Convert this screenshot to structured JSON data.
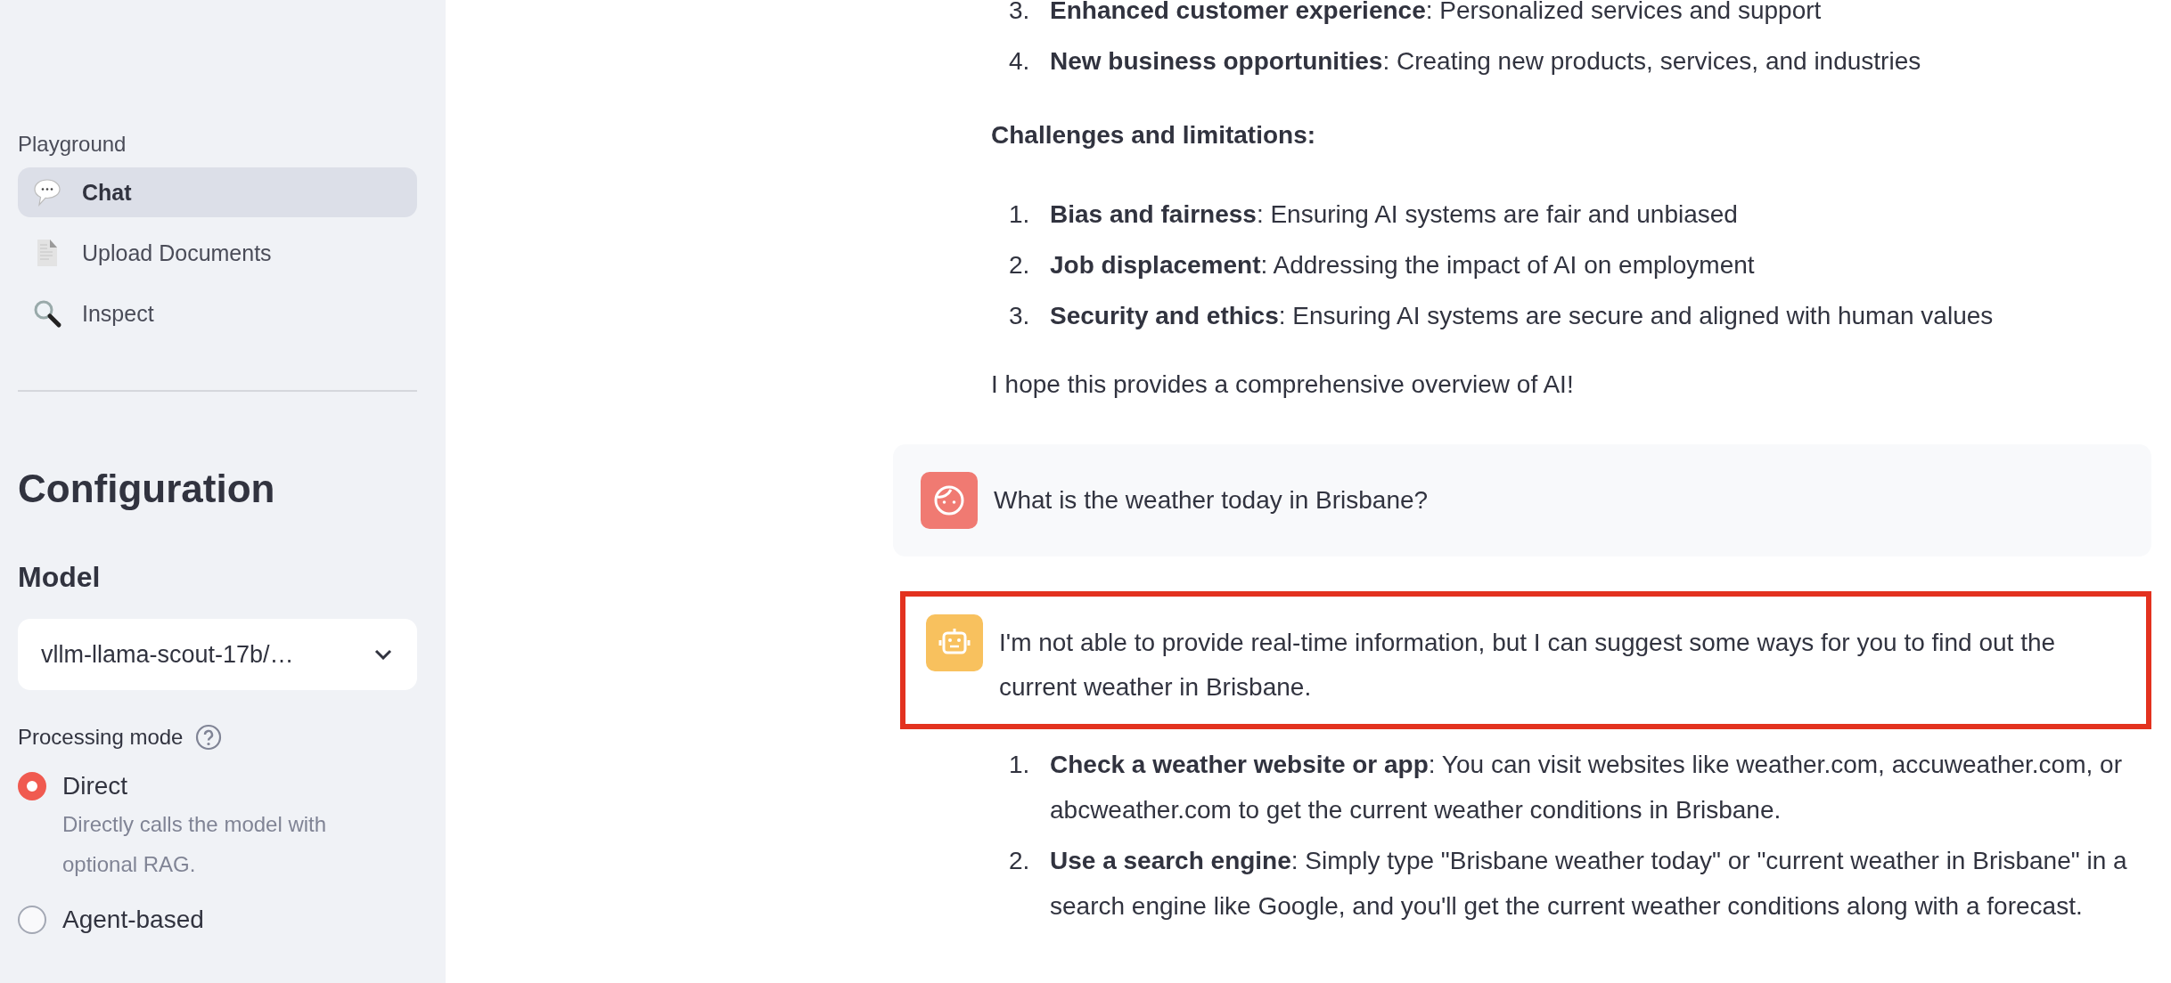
{
  "sidebar": {
    "nav_heading": "Playground",
    "nav_items": [
      {
        "label": "Chat",
        "selected": true
      },
      {
        "label": "Upload Documents",
        "selected": false
      },
      {
        "label": "Inspect",
        "selected": false
      }
    ],
    "configuration_title": "Configuration",
    "model": {
      "label": "Model",
      "value": "vllm-llama-scout-17b/…"
    },
    "processing_mode": {
      "label": "Processing mode",
      "options": [
        {
          "label": "Direct",
          "description": "Directly calls the model with optional RAG.",
          "selected": true
        },
        {
          "label": "Agent-based",
          "selected": false
        }
      ]
    }
  },
  "chat": [
    {
      "kind": "list",
      "items": [
        {
          "number": "3.",
          "text": "**Enhanced customer experience**: Personalized services and support"
        },
        {
          "number": "4.",
          "text": "**New business opportunities**: Creating new products, services, and industries"
        }
      ]
    },
    {
      "kind": "heading",
      "text": "Challenges and limitations:"
    },
    {
      "kind": "list",
      "items": [
        {
          "number": "1.",
          "text": "**Bias and fairness**: Ensuring AI systems are fair and unbiased"
        },
        {
          "number": "2.",
          "text": "**Job displacement**: Addressing the impact of AI on employment"
        },
        {
          "number": "3.",
          "text": "**Security and ethics**: Ensuring AI systems are secure and aligned with human values"
        }
      ]
    },
    {
      "kind": "paragraph",
      "text": "I hope this provides a comprehensive overview of AI!"
    },
    {
      "kind": "user_message",
      "text": "What is the weather today in Brisbane?"
    },
    {
      "kind": "assistant_message",
      "highlighted": true,
      "text": "I'm not able to provide real-time information, but I can suggest some ways for you to find out the current weather in Brisbane."
    },
    {
      "kind": "list",
      "items": [
        {
          "number": "1.",
          "text": "**Check a weather website or app**: You can visit websites like weather.com, accuweather.com, or abcweather.com to get the current weather conditions in Brisbane."
        },
        {
          "number": "2.",
          "text": "**Use a search engine**: Simply type \"Brisbane weather today\" or \"current weather in Brisbane\" in a search engine like Google, and you'll get the current weather conditions along with a forecast."
        }
      ]
    }
  ]
}
